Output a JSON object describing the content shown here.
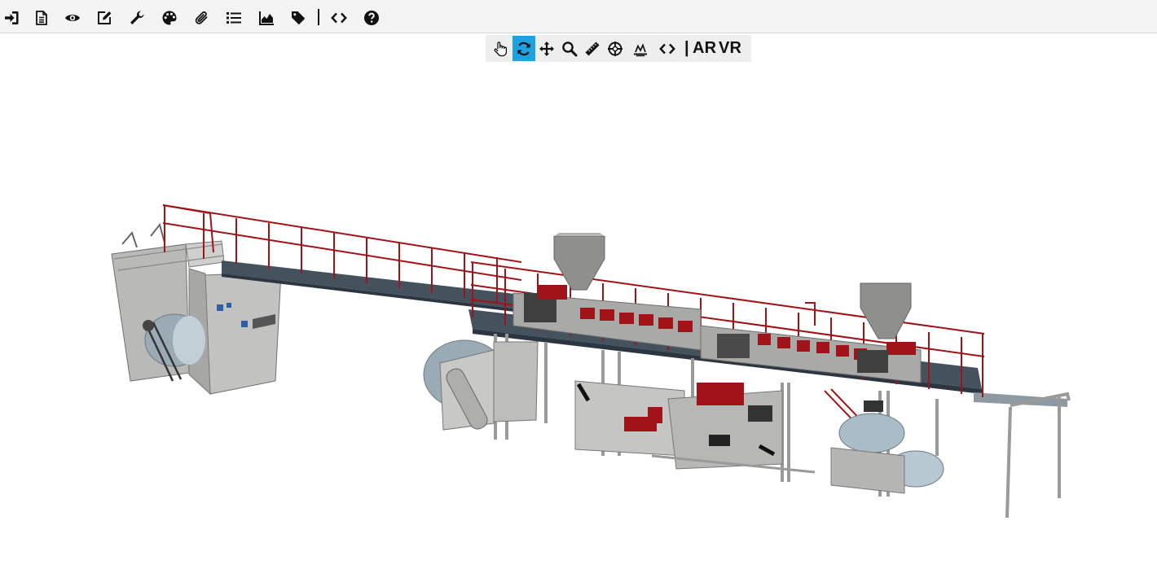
{
  "top_toolbar": {
    "buttons": [
      {
        "name": "login-icon"
      },
      {
        "name": "document-icon"
      },
      {
        "name": "eye-icon"
      },
      {
        "name": "edit-icon"
      },
      {
        "name": "wrench-icon"
      },
      {
        "name": "palette-icon"
      },
      {
        "name": "paperclip-icon"
      },
      {
        "name": "list-icon"
      },
      {
        "name": "area-chart-icon"
      },
      {
        "name": "tag-icon"
      },
      {
        "name": "code-icon"
      },
      {
        "name": "help-icon"
      }
    ]
  },
  "view_toolbar": {
    "active_tool": "rotate",
    "tools": [
      "hand",
      "rotate",
      "move",
      "zoom",
      "measure",
      "target",
      "explode",
      "code"
    ],
    "divider": "|",
    "ar_label": "AR",
    "vr_label": "VR",
    "active_color": "#1ea1e3"
  },
  "model": {
    "accent_color": "#a01318",
    "frame_color": "#b7b7b5",
    "walkway_color": "#43505b"
  }
}
